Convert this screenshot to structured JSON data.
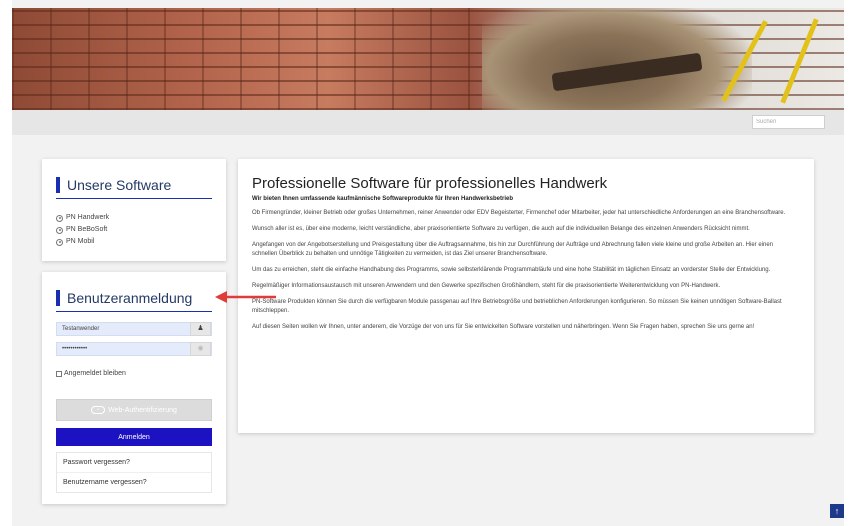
{
  "search": {
    "placeholder": "Suchen"
  },
  "software": {
    "title": "Unsere Software",
    "items": [
      {
        "label": "PN Handwerk"
      },
      {
        "label": "PN BeBoSoft"
      },
      {
        "label": "PN Mobil"
      }
    ]
  },
  "login": {
    "title": "Benutzeranmeldung",
    "username_value": "Testanwender",
    "password_value": "••••••••••••",
    "remember_label": "Angemeldet bleiben",
    "web_auth_label": "Web-Authentifizierung",
    "login_button": "Anmelden",
    "forgot_password": "Passwort vergessen?",
    "forgot_username": "Benutzername vergessen?"
  },
  "main": {
    "heading": "Professionelle Software für professionelles Handwerk",
    "subtitle": "Wir bieten Ihnen umfassende kaufmännische Softwareprodukte für Ihren Handwerksbetrieb",
    "paragraphs": [
      "Ob Firmengründer, kleiner Betrieb oder großes Unternehmen, reiner Anwender oder EDV Begeisterter, Firmenchef oder Mitarbeiter, jeder hat unterschiedliche Anforderungen an eine Branchensoftware.",
      "Wunsch aller ist es, über eine moderne, leicht verständliche, aber praxisorientierte Software zu verfügen, die auch auf die individuellen Belange des einzelnen Anwenders Rücksicht nimmt.",
      "Angefangen von der Angebotserstellung und Preisgestaltung über die Auftragsannahme, bis hin zur Durchführung der Aufträge und Abrechnung fallen viele kleine und große Arbeiten an. Hier einen schnellen Überblick zu behalten und unnötige Tätigkeiten zu vermeiden, ist das Ziel unserer Branchensoftware.",
      "Um das zu erreichen, steht die einfache Handhabung des Programms, sowie selbsterklärende Programmabläufe und eine hohe Stabilität im täglichen Einsatz an vorderster Stelle der Entwicklung.",
      "Regelmäßiger Informationsaustausch mit unseren Anwendern und den Gewerke spezifischen Großhändlern, steht für die praxisorientierte Weiterentwicklung von PN-Handwerk.",
      "PN-Software Produkten können Sie durch die verfügbaren Module passgenau auf Ihre Betriebsgröße und betrieblichen Anforderungen konfigurieren. So müssen Sie keinen unnötigen Software-Ballast mitschleppen.",
      "Auf diesen Seiten wollen wir Ihnen, unter anderem, die Vorzüge der von uns für Sie entwickelten Software vorstellen und näherbringen. Wenn Sie Fragen haben, sprechen Sie uns gerne an!"
    ]
  },
  "colors": {
    "accent": "#1d12c2",
    "title_bar": "#1a2fb0",
    "arrow": "#e03b3b",
    "scroll_top": "#1d3a8a"
  },
  "icons": {
    "user": "user-icon",
    "eye": "eye-icon",
    "fingerprint": "fingerprint-icon",
    "arrow_up": "arrow-up-icon"
  }
}
